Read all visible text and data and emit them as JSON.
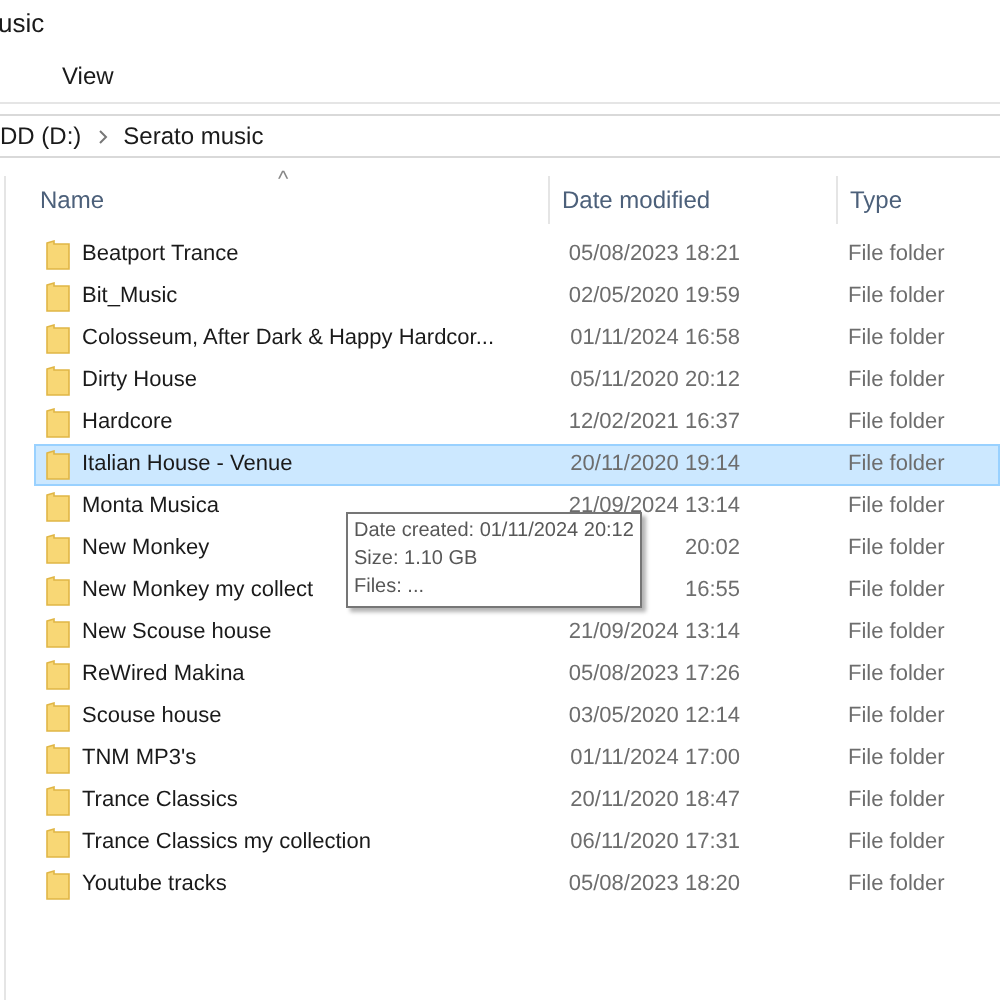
{
  "window": {
    "title": "usic"
  },
  "ribbon": {
    "tabs": [
      {
        "label": "View"
      }
    ]
  },
  "address_bar": {
    "segments": [
      "DD (D:)",
      "Serato music"
    ]
  },
  "table": {
    "sort_indicator": "^",
    "columns": [
      "Name",
      "Date modified",
      "Type"
    ],
    "rows": [
      {
        "name": "Beatport Trance",
        "date": "05/08/2023 18:21",
        "type": "File folder",
        "selected": false
      },
      {
        "name": "Bit_Music",
        "date": "02/05/2020 19:59",
        "type": "File folder",
        "selected": false
      },
      {
        "name": "Colosseum, After Dark & Happy Hardcor...",
        "date": "01/11/2024 16:58",
        "type": "File folder",
        "selected": false
      },
      {
        "name": "Dirty House",
        "date": "05/11/2020 20:12",
        "type": "File folder",
        "selected": false
      },
      {
        "name": "Hardcore",
        "date": "12/02/2021 16:37",
        "type": "File folder",
        "selected": false
      },
      {
        "name": "Italian House - Venue",
        "date": "20/11/2020 19:14",
        "type": "File folder",
        "selected": true
      },
      {
        "name": "Monta Musica",
        "date": "21/09/2024 13:14",
        "type": "File folder",
        "selected": false
      },
      {
        "name": "New Monkey",
        "date": "20:02",
        "type": "File folder",
        "selected": false
      },
      {
        "name": "New Monkey my collect",
        "date": "16:55",
        "type": "File folder",
        "selected": false
      },
      {
        "name": "New Scouse house",
        "date": "21/09/2024 13:14",
        "type": "File folder",
        "selected": false
      },
      {
        "name": "ReWired Makina",
        "date": "05/08/2023 17:26",
        "type": "File folder",
        "selected": false
      },
      {
        "name": "Scouse house",
        "date": "03/05/2020 12:14",
        "type": "File folder",
        "selected": false
      },
      {
        "name": "TNM MP3's",
        "date": "01/11/2024 17:00",
        "type": "File folder",
        "selected": false
      },
      {
        "name": "Trance Classics",
        "date": "20/11/2020 18:47",
        "type": "File folder",
        "selected": false
      },
      {
        "name": "Trance Classics my collection",
        "date": "06/11/2020 17:31",
        "type": "File folder",
        "selected": false
      },
      {
        "name": "Youtube tracks",
        "date": "05/08/2023 18:20",
        "type": "File folder",
        "selected": false
      }
    ]
  },
  "tooltip": {
    "lines": [
      "Date created: 01/11/2024 20:12",
      "Size: 1.10 GB",
      "Files: ..."
    ]
  }
}
